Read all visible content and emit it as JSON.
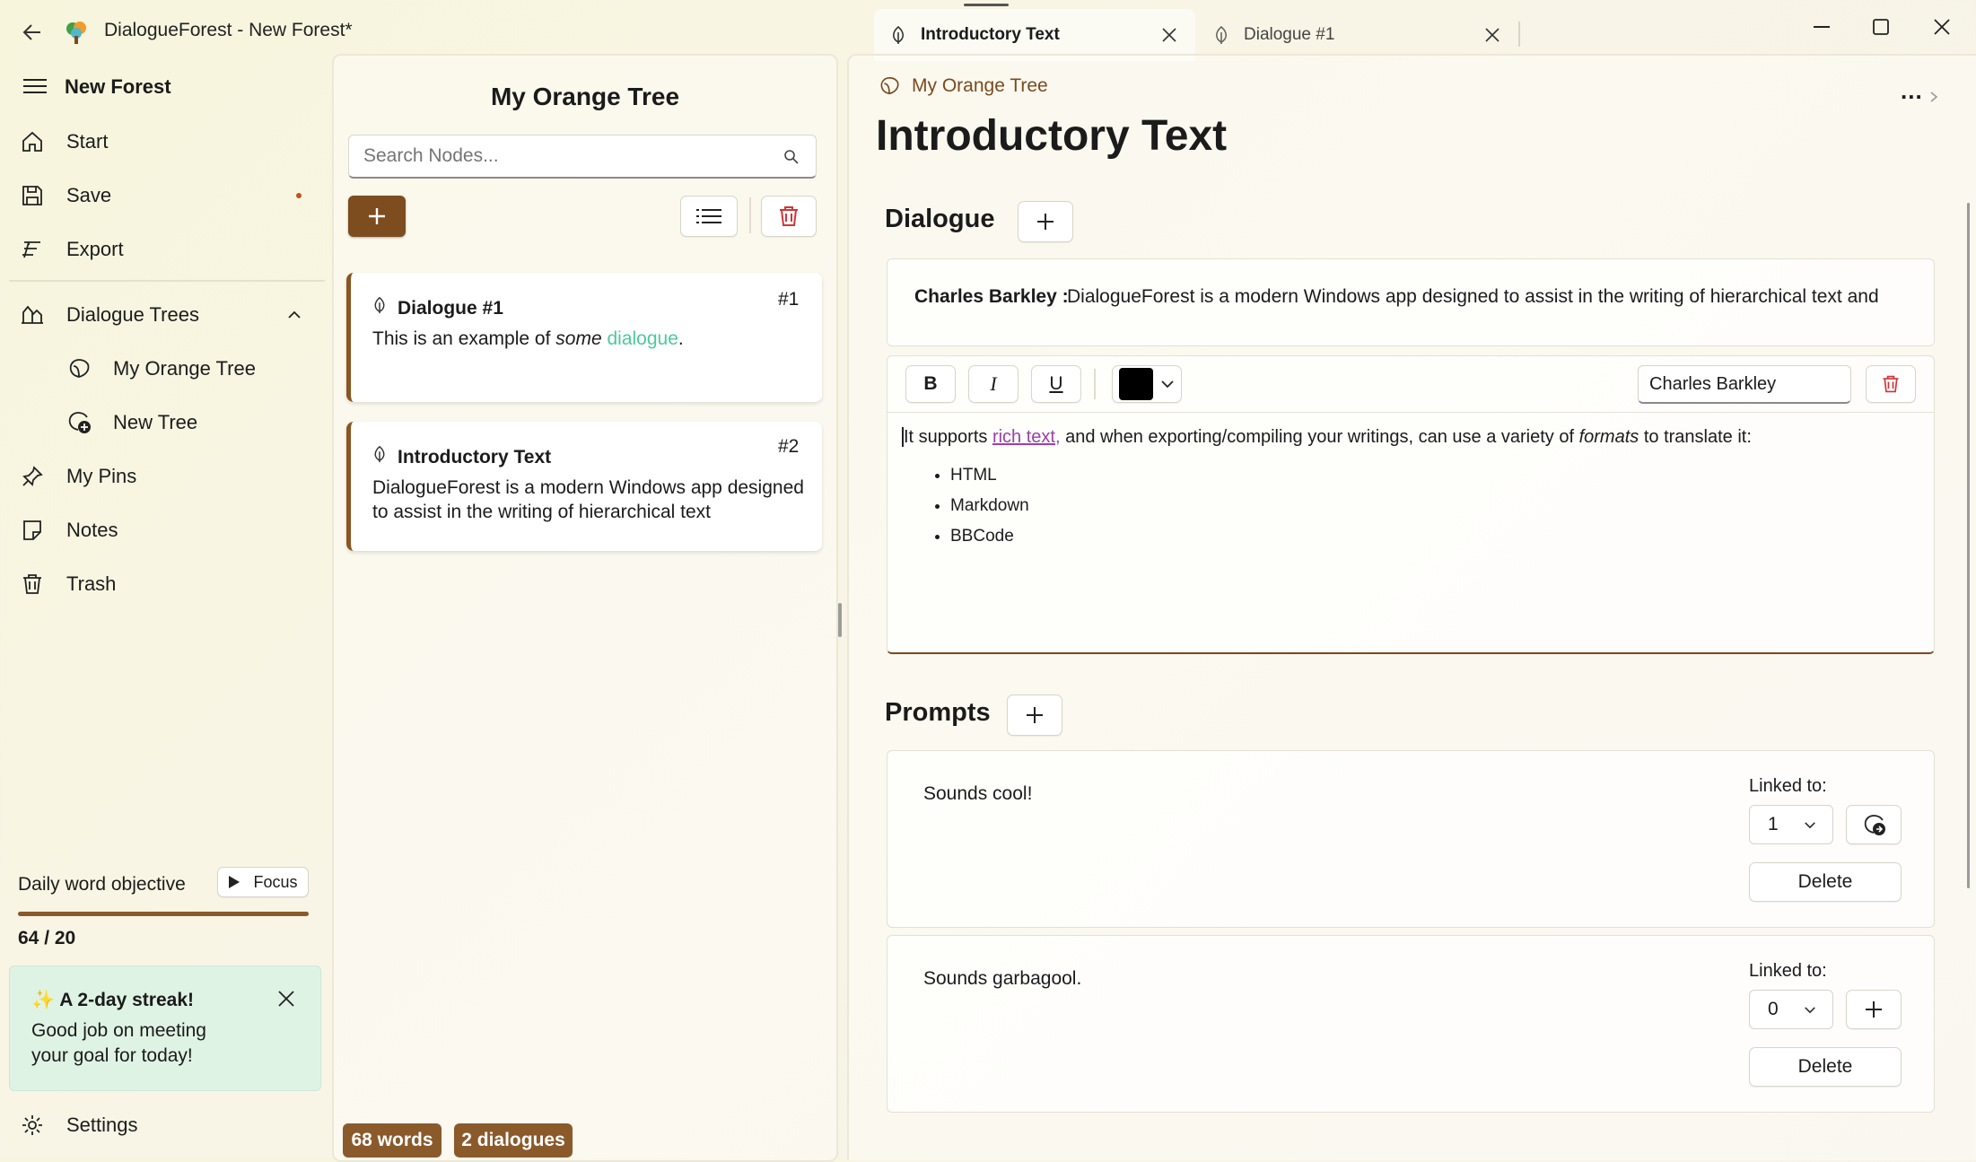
{
  "window": {
    "title": "DialogueForest - New Forest*"
  },
  "tabs": [
    {
      "label": "Introductory Text",
      "active": true
    },
    {
      "label": "Dialogue #1",
      "active": false
    }
  ],
  "nav": {
    "forest_name": "New Forest",
    "items": [
      {
        "label": "Start",
        "icon": "home-icon"
      },
      {
        "label": "Save",
        "icon": "save-icon",
        "unsaved_dot": true
      },
      {
        "label": "Export",
        "icon": "export-icon"
      }
    ],
    "trees_header": "Dialogue Trees",
    "trees": [
      {
        "label": "My Orange Tree",
        "icon": "tree-icon"
      },
      {
        "label": "New Tree",
        "icon": "new-tree-icon"
      }
    ],
    "lower_items": [
      {
        "label": "My Pins",
        "icon": "pin-icon"
      },
      {
        "label": "Notes",
        "icon": "note-icon"
      },
      {
        "label": "Trash",
        "icon": "trash-icon"
      }
    ],
    "objective": {
      "label": "Daily word objective",
      "focus_label": "Focus",
      "progress_text": "64 / 20",
      "progress": 1.0
    },
    "streak": {
      "title": "✨ A 2-day streak!",
      "message": "Good job on meeting your goal for today!"
    },
    "settings_label": "Settings"
  },
  "tree_panel": {
    "title": "My Orange Tree",
    "search_placeholder": "Search Nodes...",
    "nodes": [
      {
        "title": "Dialogue #1",
        "number": "#1",
        "preview_pre": "This is an example of ",
        "preview_em": "some",
        "preview_link": "dialogue",
        "preview_post": "."
      },
      {
        "title": "Introductory Text",
        "number": "#2",
        "preview": "DialogueForest is a modern Windows app designed to assist in the writing of hierarchical text"
      }
    ],
    "stats": {
      "words": "68 words",
      "dialogues": "2 dialogues"
    }
  },
  "editor": {
    "breadcrumb": "My Orange Tree",
    "more": "...",
    "node_title": "Introductory Text",
    "dialogue_header": "Dialogue",
    "dialogue_lines": [
      {
        "speaker": "Charles Barkley :",
        "text": "DialogueForest is a modern Windows app designed to assist in the writing of hierarchical text and"
      }
    ],
    "toolbar": {
      "bold": "B",
      "italic": "I",
      "underline": "U",
      "color": "#000000",
      "speaker": "Charles Barkley"
    },
    "richtext": {
      "pre": "It supports ",
      "link": "rich text,",
      "mid": " and when exporting/compiling your writings, can use a variety of ",
      "em": "formats",
      "post": " to translate it:",
      "bullets": [
        "HTML",
        "Markdown",
        "BBCode"
      ]
    },
    "prompts_header": "Prompts",
    "prompts": [
      {
        "text": "Sounds cool!",
        "linked_label": "Linked to:",
        "linked_value": "1",
        "action_icon": "go-to-node-icon",
        "delete_label": "Delete"
      },
      {
        "text": "Sounds garbagool.",
        "linked_label": "Linked to:",
        "linked_value": "0",
        "action_icon": "plus-icon",
        "delete_label": "Delete"
      }
    ]
  },
  "colors": {
    "accent": "#8b5a2b",
    "link_green": "#4fc99a",
    "link_purple": "#9b3fa8",
    "delete_red": "#d13438",
    "streak_bg": "#dff3e4"
  }
}
